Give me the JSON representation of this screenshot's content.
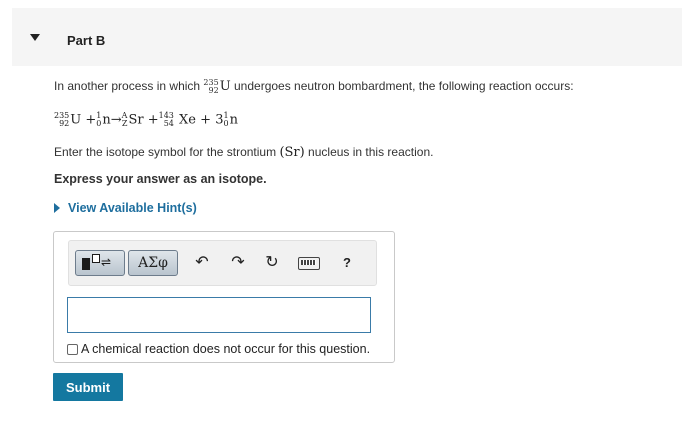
{
  "part": {
    "title": "Part B"
  },
  "question": {
    "intro_before": "In another process in which ",
    "intro_after": " undergoes neutron bombardment, the following reaction occurs:",
    "u235": {
      "mass": "235",
      "atomic": "92",
      "symbol": "U"
    },
    "reaction": {
      "u_mass": "235",
      "u_atomic": "92",
      "u_symbol": "U",
      "plus1": "+",
      "n1_mass": "1",
      "n1_atomic": "0",
      "n1_symbol": "n",
      "arrow": "→",
      "sr_mass": "A",
      "sr_atomic": "Z",
      "sr_symbol": "Sr",
      "plus2": "+",
      "xe_mass": "143",
      "xe_atomic": "54",
      "xe_symbol": "Xe",
      "plus3": "+",
      "n2_coef": "3",
      "n2_mass": "1",
      "n2_atomic": "0",
      "n2_symbol": "n"
    },
    "instruction_before": "Enter the isotope symbol for the strontium ",
    "instruction_sr": "(Sr)",
    "instruction_after": " nucleus in this reaction.",
    "express": "Express your answer as an isotope."
  },
  "hint": {
    "label": "View Available Hint(s)"
  },
  "toolbar": {
    "greek_label": "ΑΣφ",
    "undo_icon": "↶",
    "redo_icon": "↷",
    "reset_icon": "↻",
    "help_label": "?"
  },
  "answer": {
    "value": "",
    "no_reaction_label": "A chemical reaction does not occur for this question."
  },
  "submit": {
    "label": "Submit"
  },
  "colors": {
    "link": "#1e6e9e",
    "submit_bg": "#1478a0",
    "input_border": "#3a7ba8"
  }
}
